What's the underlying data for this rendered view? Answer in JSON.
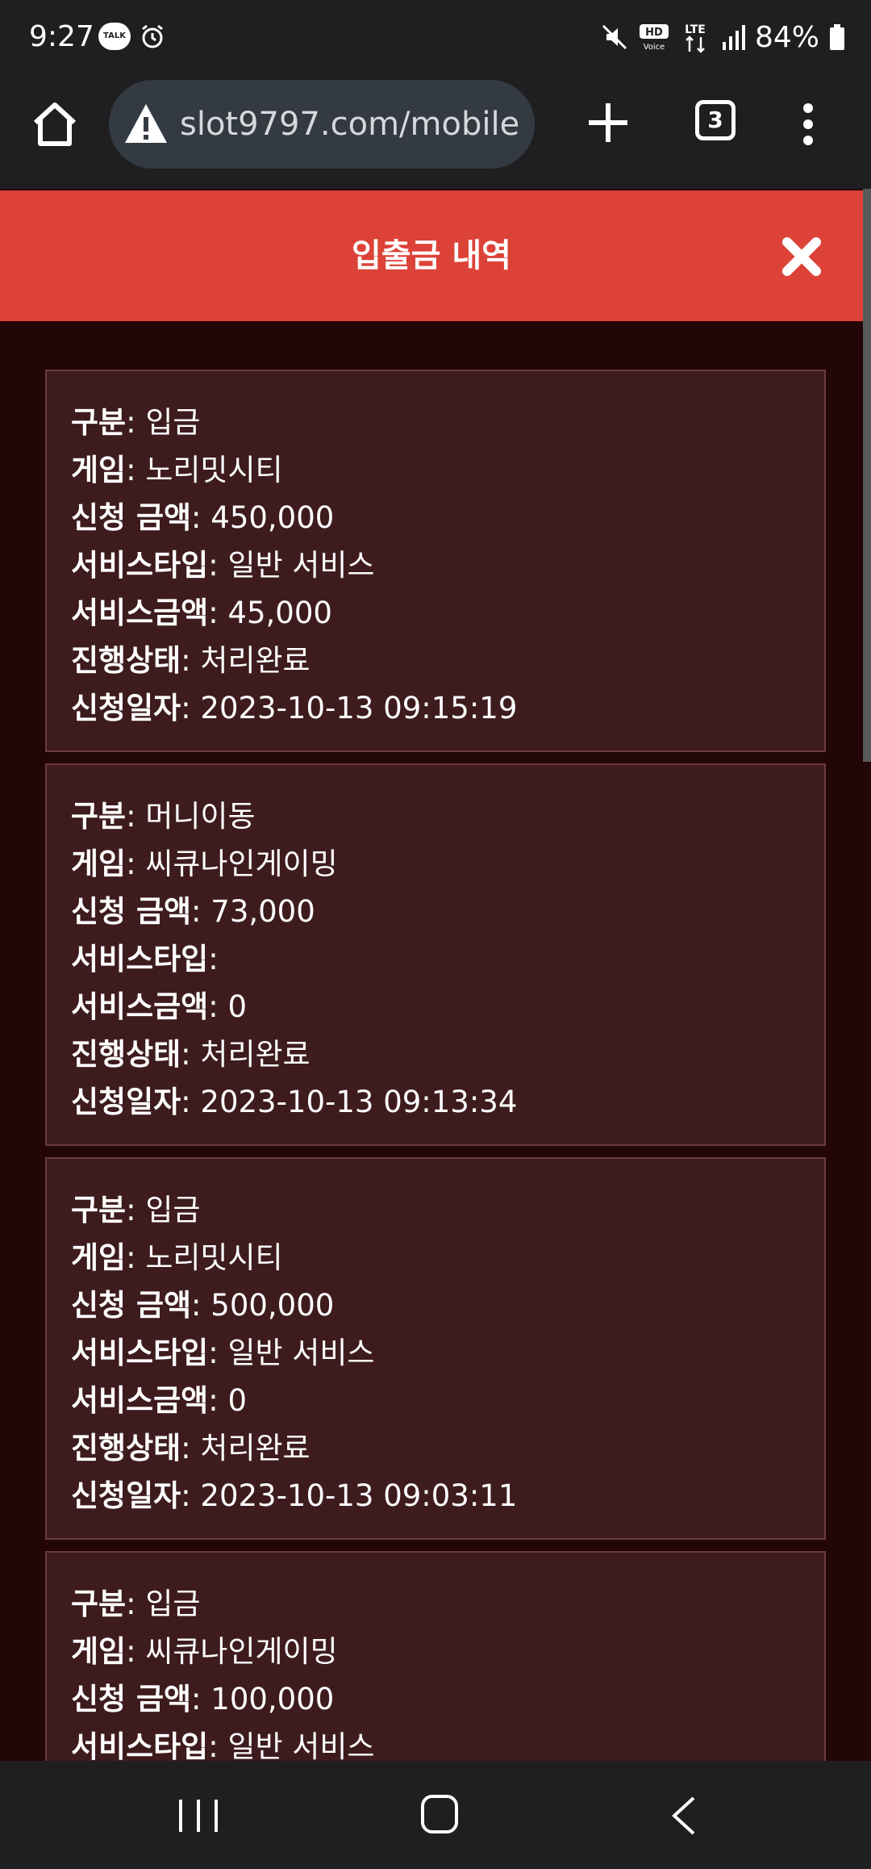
{
  "status_bar": {
    "time": "9:27",
    "talk_badge": "TALK",
    "battery": "84%",
    "icons": [
      "kakaotalk-icon",
      "alarm-icon",
      "mute-icon",
      "hd-voice-icon",
      "lte-icon",
      "signal-icon",
      "battery-icon"
    ]
  },
  "browser": {
    "url": "slot9797.com/mobile",
    "tab_count": "3",
    "icons": [
      "home-icon",
      "warning-icon",
      "plus-icon",
      "tabs-icon",
      "more-vert-icon"
    ]
  },
  "modal": {
    "title": "입출금 내역",
    "close_icon": "close-icon",
    "header_color": "#dc4237"
  },
  "records": [
    {
      "type_label": "구분",
      "type": "입금",
      "game_label": "게임",
      "game": "노리밋시티",
      "amount_label": "신청 금액",
      "amount": "450,000",
      "service_type_label": "서비스타입",
      "service_type": "일반 서비스",
      "service_amount_label": "서비스금액",
      "service_amount": "45,000",
      "status_label": "진행상태",
      "status": "처리완료",
      "date_label": "신청일자",
      "date": "2023-10-13 09:15:19"
    },
    {
      "type_label": "구분",
      "type": "머니이동",
      "game_label": "게임",
      "game": "씨큐나인게이밍",
      "amount_label": "신청 금액",
      "amount": "73,000",
      "service_type_label": "서비스타입",
      "service_type": "",
      "service_amount_label": "서비스금액",
      "service_amount": "0",
      "status_label": "진행상태",
      "status": "처리완료",
      "date_label": "신청일자",
      "date": "2023-10-13 09:13:34"
    },
    {
      "type_label": "구분",
      "type": "입금",
      "game_label": "게임",
      "game": "노리밋시티",
      "amount_label": "신청 금액",
      "amount": "500,000",
      "service_type_label": "서비스타입",
      "service_type": "일반 서비스",
      "service_amount_label": "서비스금액",
      "service_amount": "0",
      "status_label": "진행상태",
      "status": "처리완료",
      "date_label": "신청일자",
      "date": "2023-10-13 09:03:11"
    },
    {
      "type_label": "구분",
      "type": "입금",
      "game_label": "게임",
      "game": "씨큐나인게이밍",
      "amount_label": "신청 금액",
      "amount": "100,000",
      "service_type_label": "서비스타입",
      "service_type": "일반 서비스"
    }
  ],
  "nav_bar": {
    "icons": [
      "recent-apps-icon",
      "home-icon",
      "back-icon"
    ]
  }
}
